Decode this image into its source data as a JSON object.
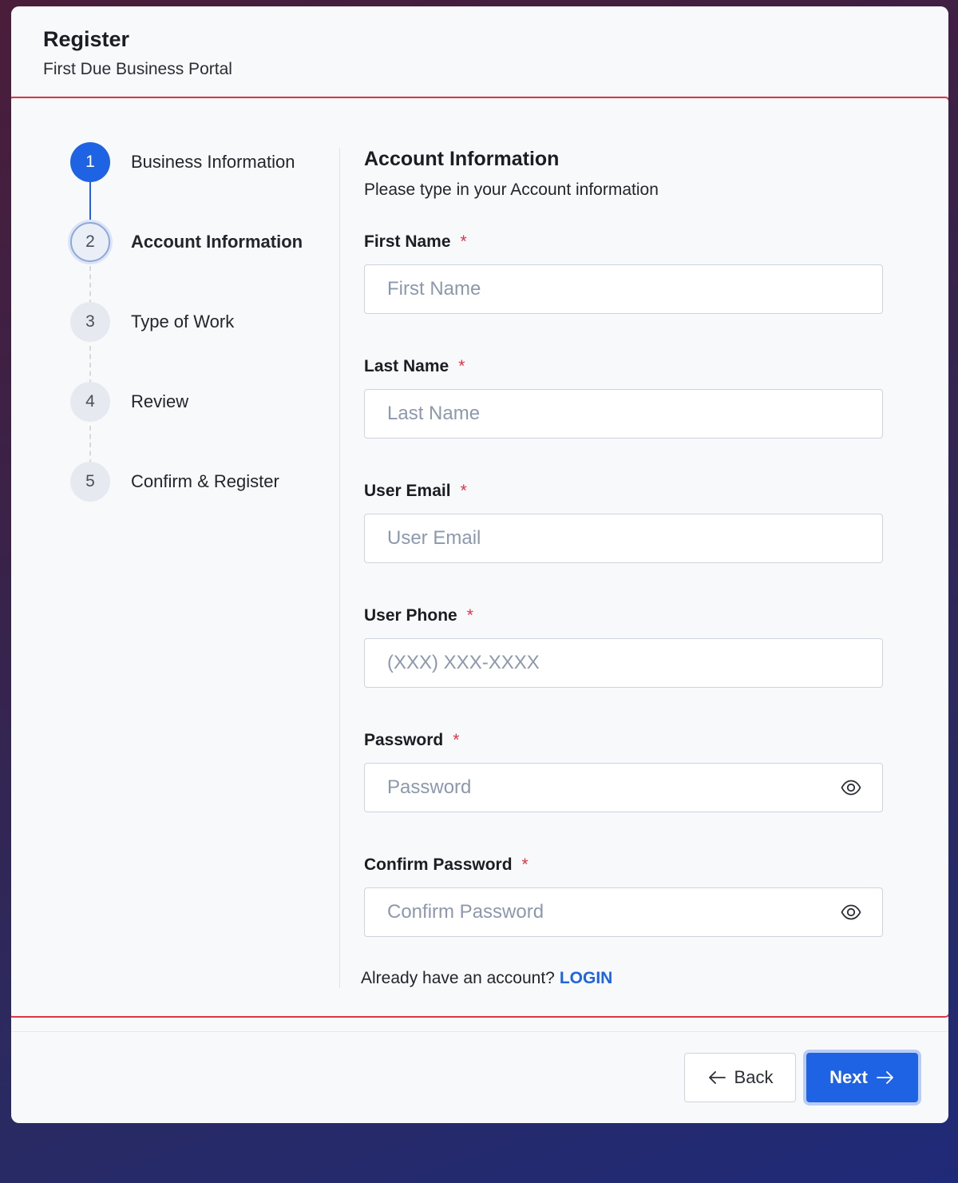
{
  "header": {
    "title": "Register",
    "subtitle": "First Due Business Portal"
  },
  "stepper": {
    "steps": [
      {
        "number": "1",
        "label": "Business Information",
        "state": "completed"
      },
      {
        "number": "2",
        "label": "Account Information",
        "state": "active"
      },
      {
        "number": "3",
        "label": "Type of Work",
        "state": "pending"
      },
      {
        "number": "4",
        "label": "Review",
        "state": "pending"
      },
      {
        "number": "5",
        "label": "Confirm & Register",
        "state": "pending"
      }
    ]
  },
  "form": {
    "title": "Account Information",
    "description": "Please type in your Account information",
    "required_marker": "*",
    "fields": {
      "first_name": {
        "label": "First Name",
        "placeholder": "First Name",
        "value": ""
      },
      "last_name": {
        "label": "Last Name",
        "placeholder": "Last Name",
        "value": ""
      },
      "email": {
        "label": "User Email",
        "placeholder": "User Email",
        "value": ""
      },
      "phone": {
        "label": "User Phone",
        "placeholder": "(XXX) XXX-XXXX",
        "value": ""
      },
      "password": {
        "label": "Password",
        "placeholder": "Password",
        "value": "",
        "icon": "eye-icon"
      },
      "confirm_password": {
        "label": "Confirm Password",
        "placeholder": "Confirm Password",
        "value": "",
        "icon": "eye-icon"
      }
    },
    "login_prompt": "Already have an account?",
    "login_link": "LOGIN"
  },
  "footer": {
    "back_label": "Back",
    "next_label": "Next"
  },
  "colors": {
    "accent": "#1f63e5",
    "required": "#e03445",
    "highlight_border": "#e03445"
  }
}
